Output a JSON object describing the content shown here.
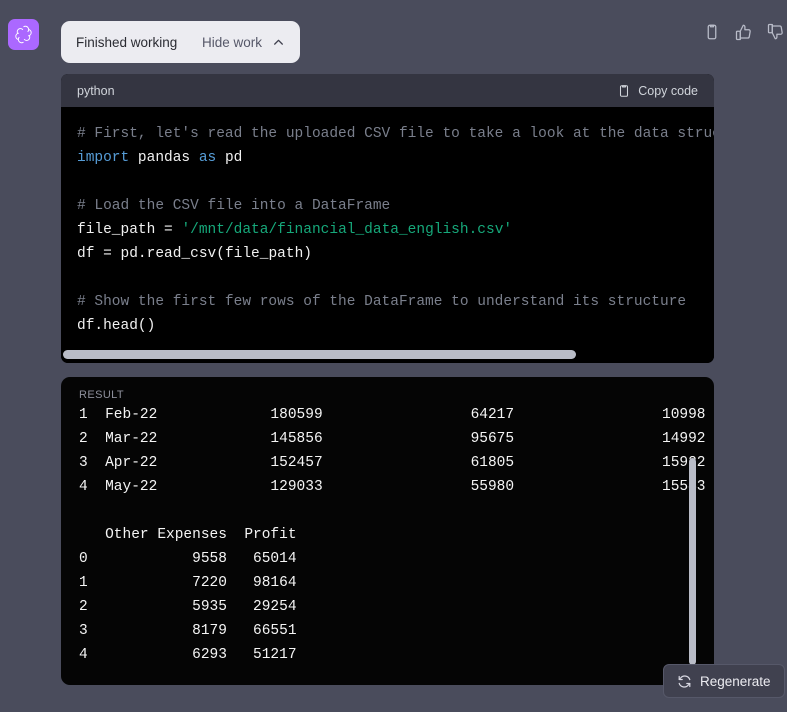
{
  "avatar": {
    "icon": "openai-logo-icon",
    "background": "#ab68ff"
  },
  "top_actions": [
    {
      "name": "copy-message-icon",
      "label": "Copy"
    },
    {
      "name": "thumbs-up-icon",
      "label": "Good response"
    },
    {
      "name": "thumbs-down-icon",
      "label": "Bad response"
    }
  ],
  "work_pill": {
    "status_label": "Finished working",
    "toggle_label": "Hide work",
    "chevron": "chevron-up-icon"
  },
  "code_block": {
    "language_label": "python",
    "copy_button_label": "Copy code",
    "copy_button_icon": "clipboard-icon",
    "lines": [
      {
        "type": "comment",
        "text": "# First, let's read the uploaded CSV file to take a look at the data structure"
      },
      {
        "type": "code",
        "text": "import pandas as pd"
      },
      {
        "type": "blank",
        "text": ""
      },
      {
        "type": "comment",
        "text": "# Load the CSV file into a DataFrame"
      },
      {
        "type": "code",
        "text": "file_path = '/mnt/data/financial_data_english.csv'"
      },
      {
        "type": "code",
        "text": "df = pd.read_csv(file_path)"
      },
      {
        "type": "blank",
        "text": ""
      },
      {
        "type": "comment",
        "text": "# Show the first few rows of the DataFrame to understand its structure"
      },
      {
        "type": "code",
        "text": "df.head()"
      }
    ],
    "horizontal_scrollbar": {
      "visible": true,
      "thumb_fraction": 0.79
    }
  },
  "result_block": {
    "label": "RESULT",
    "vertical_scrollbar": {
      "visible": true,
      "thumb_fraction": 0.67
    },
    "table_top": {
      "rows": [
        {
          "index": "1",
          "month": "Feb-22",
          "col_a": "180599",
          "col_b": "64217",
          "col_c": "10998"
        },
        {
          "index": "2",
          "month": "Mar-22",
          "col_a": "145856",
          "col_b": "95675",
          "col_c": "14992"
        },
        {
          "index": "3",
          "month": "Apr-22",
          "col_a": "152457",
          "col_b": "61805",
          "col_c": "15922"
        },
        {
          "index": "4",
          "month": "May-22",
          "col_a": "129033",
          "col_b": "55980",
          "col_c": "15543"
        }
      ]
    },
    "table_bottom": {
      "headers": [
        "Other Expenses",
        "Profit"
      ],
      "rows": [
        {
          "index": "0",
          "other_expenses": "9558",
          "profit": "65014"
        },
        {
          "index": "1",
          "other_expenses": "7220",
          "profit": "98164"
        },
        {
          "index": "2",
          "other_expenses": "5935",
          "profit": "29254"
        },
        {
          "index": "3",
          "other_expenses": "8179",
          "profit": "66551"
        },
        {
          "index": "4",
          "other_expenses": "6293",
          "profit": "51217"
        }
      ]
    },
    "rendered_text": "1  Feb-22             180599                 64217                 10998\n2  Mar-22             145856                 95675                 14992\n3  Apr-22             152457                 61805                 15922\n4  May-22             129033                 55980                 15543\n\n   Other Expenses  Profit\n0            9558   65014\n1            7220   98164\n2            5935   29254\n3            8179   66551\n4            6293   51217"
  },
  "regenerate": {
    "label": "Regenerate",
    "icon": "refresh-icon"
  },
  "colors": {
    "page_background": "#4a4c5c",
    "code_background": "#000000",
    "code_header": "#343541",
    "pill_background": "#ececf1",
    "accent_avatar": "#ab68ff",
    "scrollbar": "#b9bcc7",
    "comment_text": "#7a7f8c",
    "keyword_text": "#569cd6",
    "string_text": "#16a87a"
  }
}
